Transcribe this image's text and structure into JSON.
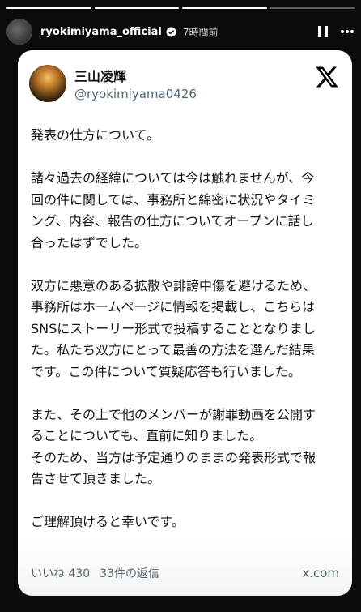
{
  "header": {
    "username": "ryokimiyama_official",
    "time": "7時間前"
  },
  "post": {
    "display_name": "三山凌輝",
    "handle": "@ryokimiyama0426",
    "paragraphs": [
      [
        "発表の仕方について。"
      ],
      [
        "諸々過去の経緯については今は触れませんが、今",
        "回の件に関しては、事務所と綿密に状況やタイミ",
        "ング、内容、報告の仕方についてオープンに話し",
        "合ったはずでした。"
      ],
      [
        "双方に悪意のある拡散や誹謗中傷を避けるため、",
        "事務所はホームページに情報を掲載し、こちらは",
        "SNSにストーリー形式で投稿することとなりまし",
        "た。私たち双方にとって最善の方法を選んだ結果",
        "です。この件について質疑応答も行いました。"
      ],
      [
        "また、その上で他のメンバーが謝罪動画を公開す",
        "ることについても、直前に知りました。",
        "そのため、当方は予定通りのままの発表形式で報",
        "告させて頂きました。"
      ],
      [
        "ご理解頂けると幸いです。"
      ]
    ],
    "likes": "いいね 430",
    "replies": "33件の返信",
    "domain": "x.com"
  },
  "colors": {
    "background": "#0b0b0b",
    "card": "#ffffff",
    "text": "#0f1419",
    "muted": "#536471"
  },
  "icons": {
    "verified": "verified-badge-icon",
    "pause": "pause-icon",
    "more": "more-options-icon",
    "x_logo": "x-logo-icon"
  }
}
